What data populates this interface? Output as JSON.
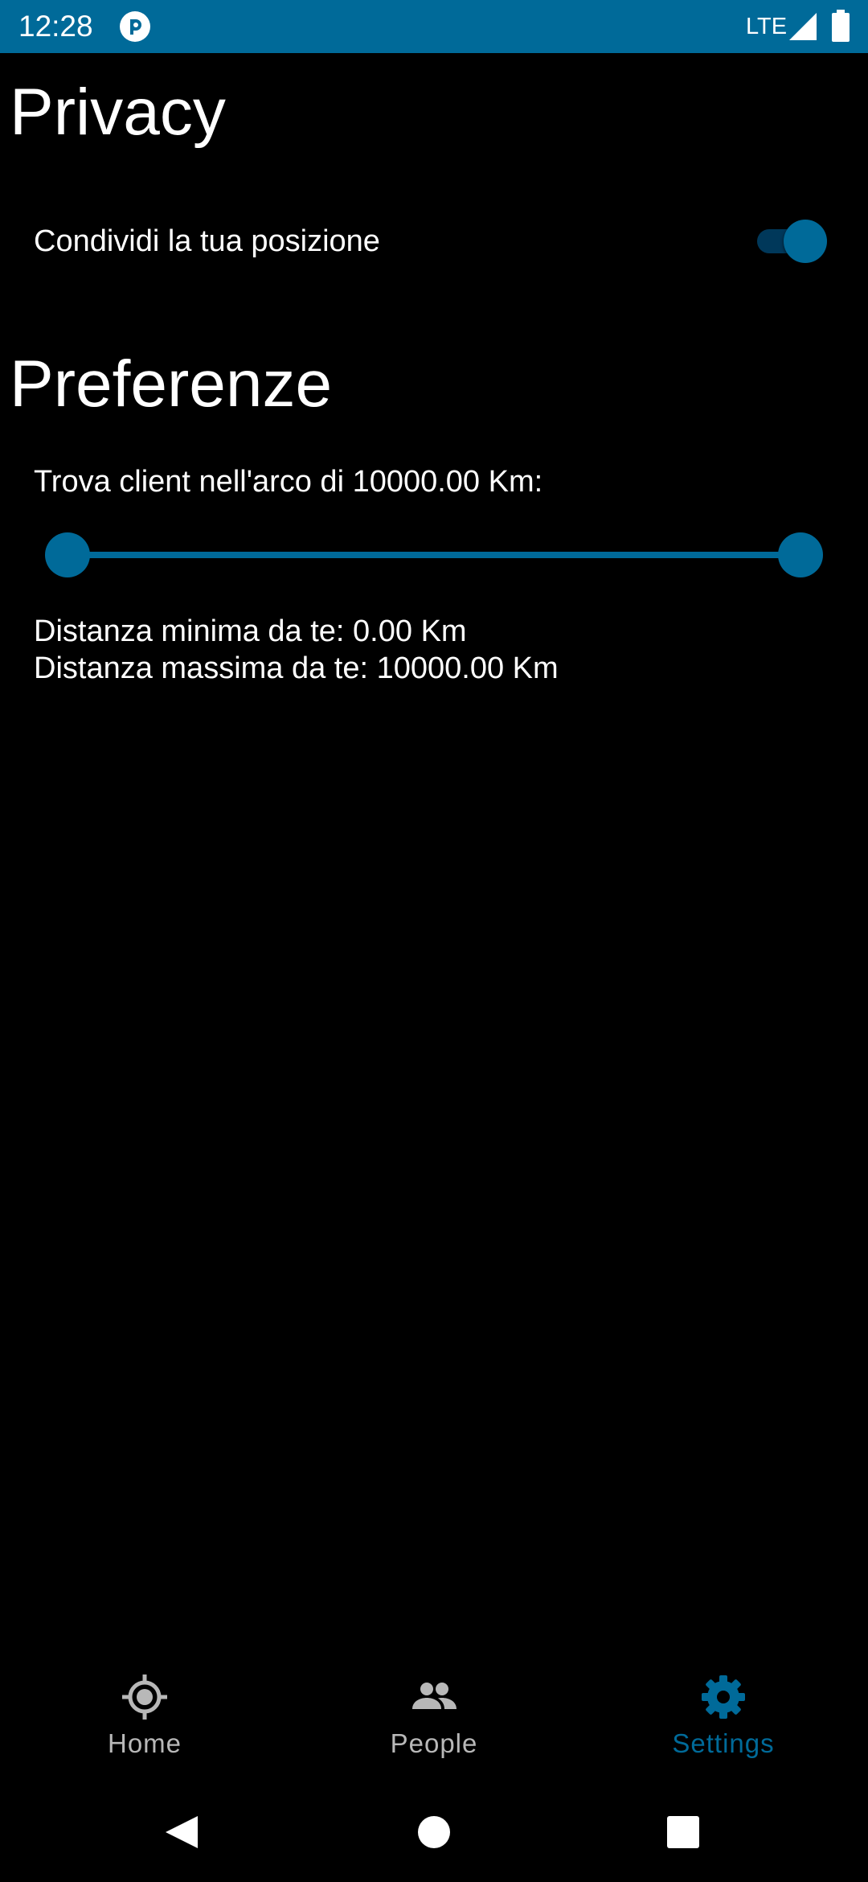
{
  "status_bar": {
    "time": "12:28",
    "network": "LTE",
    "app_icon": "app-logo-icon",
    "signal_icon": "signal-icon",
    "battery_icon": "battery-icon",
    "background_color": "#006a99"
  },
  "privacy": {
    "title": "Privacy",
    "share_location_label": "Condividi la tua posizione",
    "share_location_enabled": true
  },
  "preferences": {
    "title": "Preferenze",
    "range_label": "Trova client nell'arco di 10000.00 Km:",
    "slider": {
      "min_value": 0.0,
      "max_value": 10000.0,
      "unit": "Km"
    },
    "min_distance_text": "Distanza minima da te: 0.00 Km",
    "max_distance_text": "Distanza massima da te: 10000.00 Km"
  },
  "bottom_nav": {
    "items": [
      {
        "label": "Home",
        "icon": "location-target-icon",
        "active": false
      },
      {
        "label": "People",
        "icon": "people-icon",
        "active": false
      },
      {
        "label": "Settings",
        "icon": "gear-icon",
        "active": true
      }
    ],
    "active_color": "#006a99",
    "inactive_color": "#b8b8b8"
  },
  "system_nav": {
    "back_icon": "back-triangle-icon",
    "home_icon": "home-circle-icon",
    "recents_icon": "recents-square-icon"
  },
  "colors": {
    "accent": "#006a99",
    "background": "#000000",
    "text": "#ffffff"
  }
}
